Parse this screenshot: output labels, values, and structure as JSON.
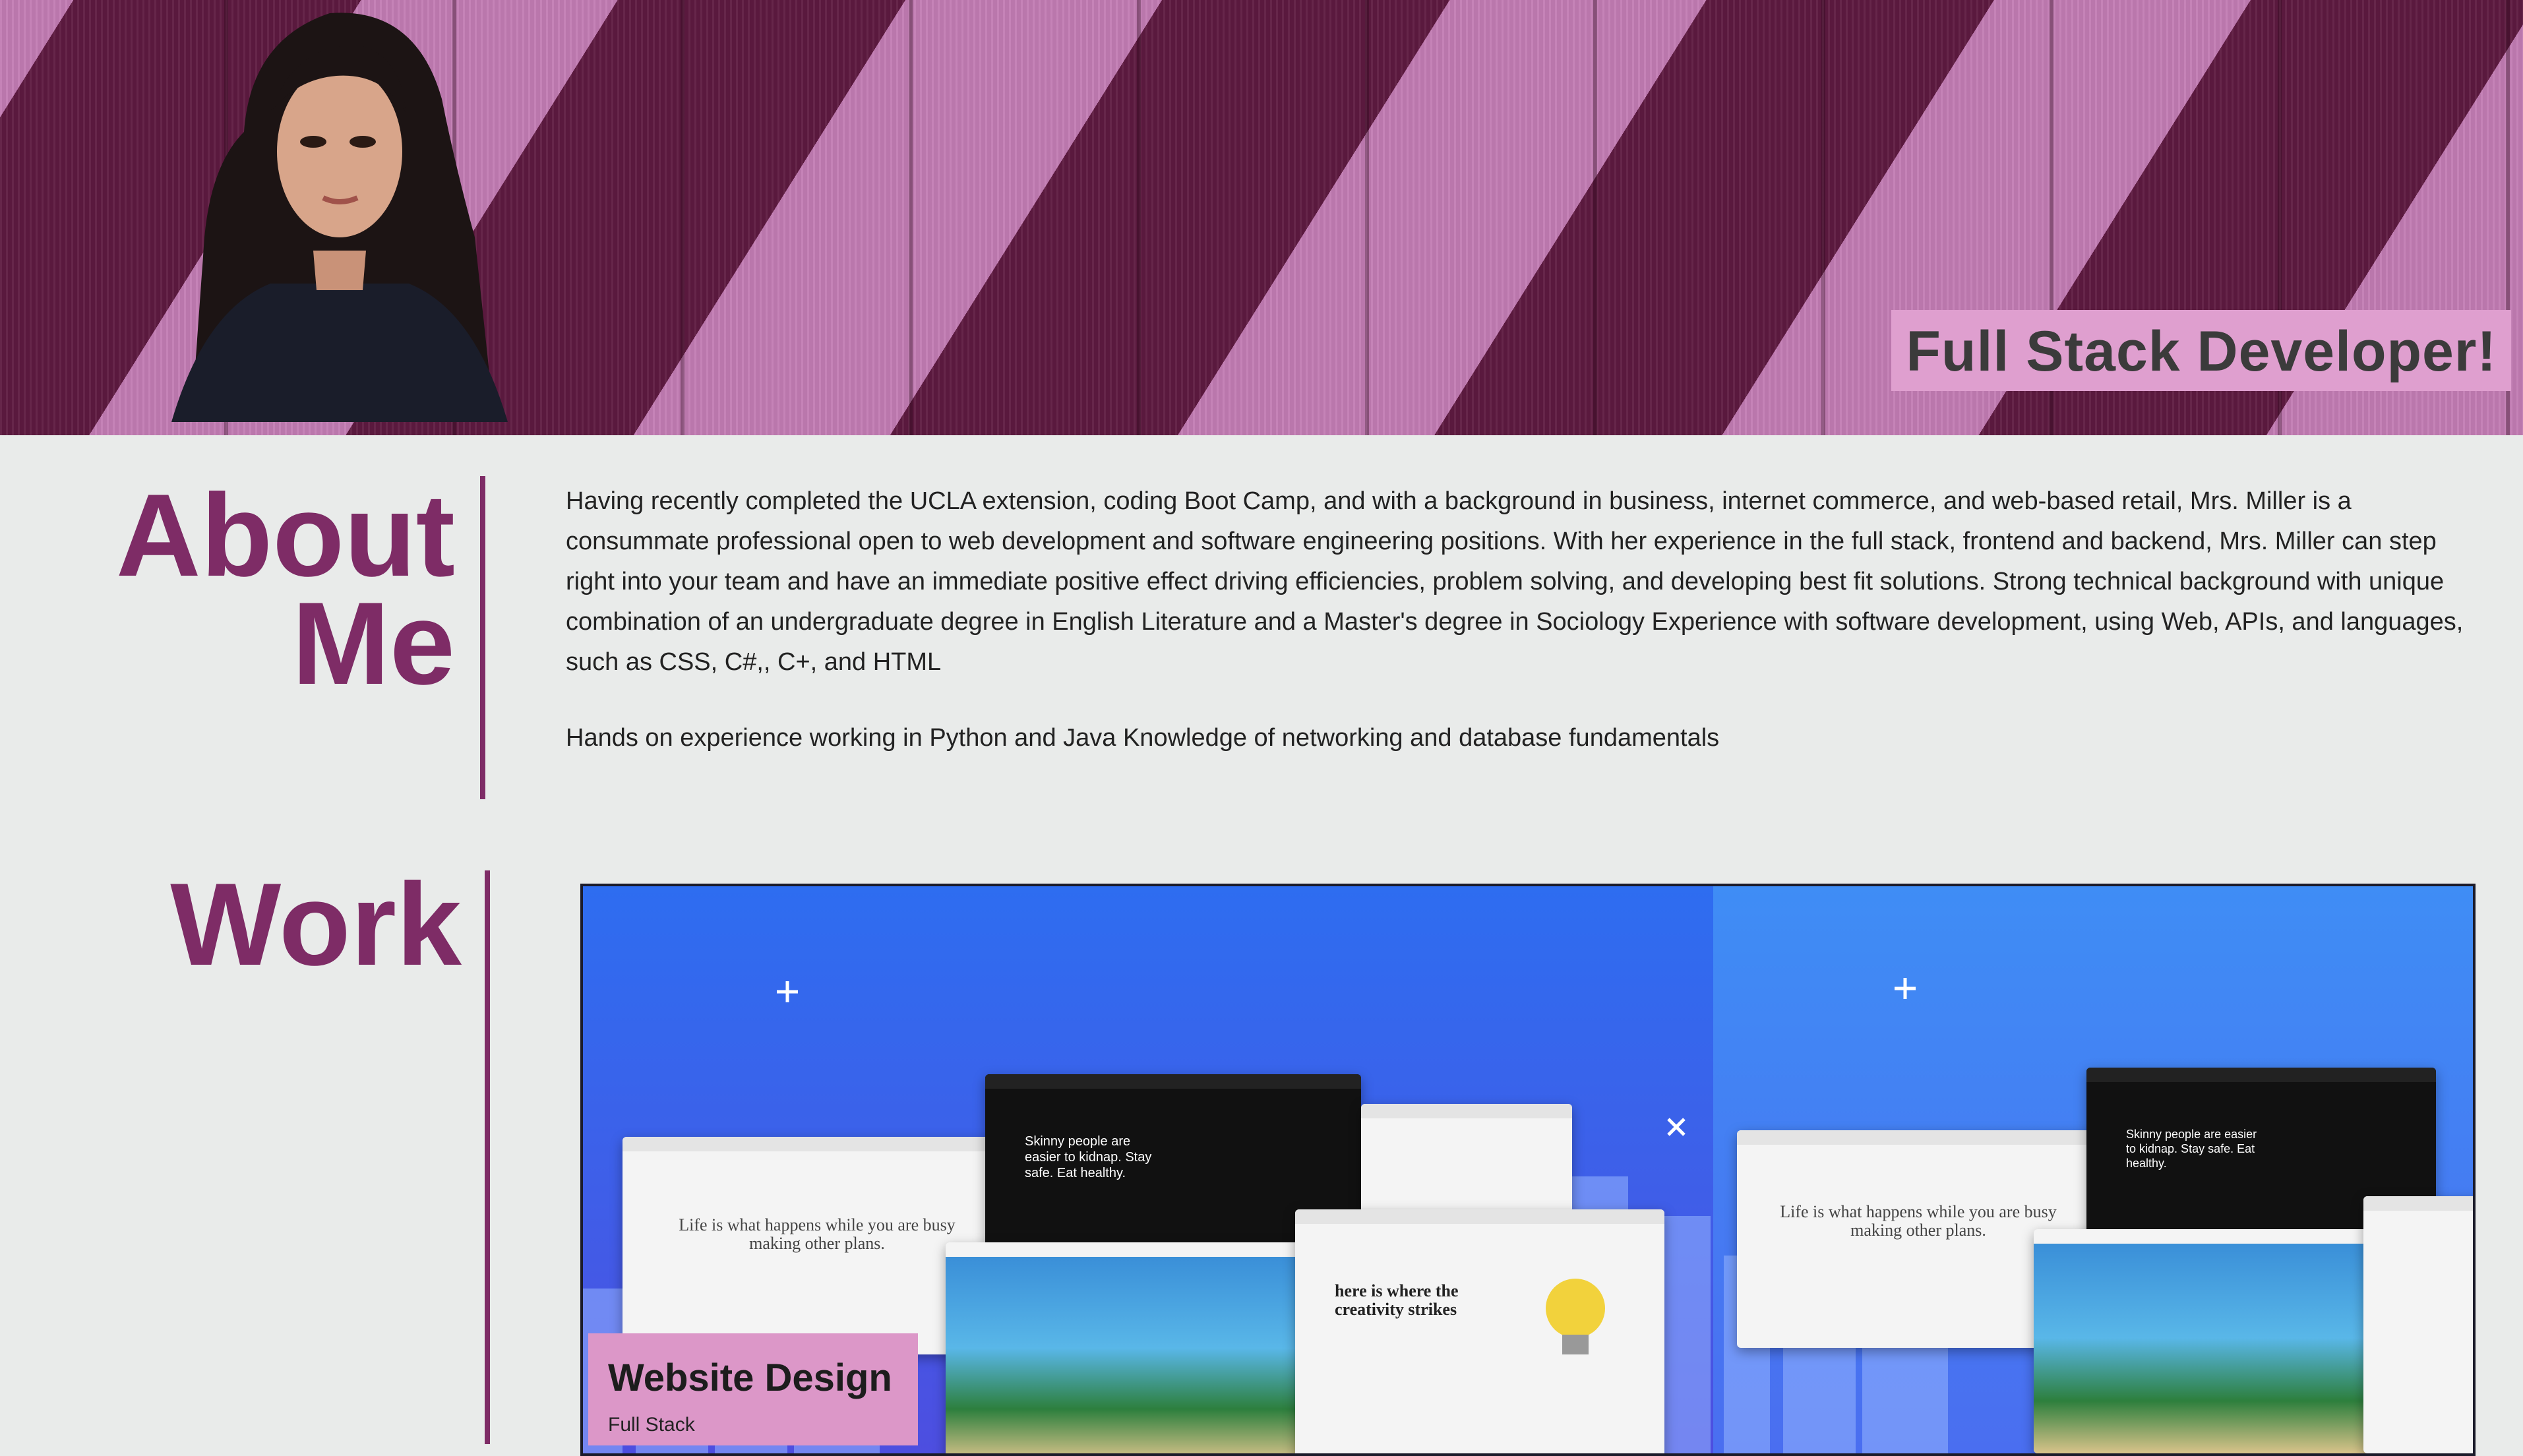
{
  "hero": {
    "title": "Full Stack Developer!"
  },
  "about": {
    "heading_line1": "About",
    "heading_line2": "Me",
    "paragraph1": "Having recently completed the UCLA extension, coding Boot Camp, and with a background in business, internet commerce, and web-based retail, Mrs. Miller is a consummate professional open to web development and software engineering positions. With her experience in the full stack, frontend and backend, Mrs. Miller can step right into your team and have an immediate positive effect driving efficiencies, problem solving, and developing best fit solutions. Strong technical background with unique combination of an undergraduate degree in English Literature and a Master's degree in Sociology Experience with software development, using Web, APIs, and languages, such as CSS, C#,, C+, and HTML",
    "paragraph2": "Hands on experience working in Python and Java Knowledge of networking and database fundamentals"
  },
  "work": {
    "heading": "Work",
    "card": {
      "title": "Website Design",
      "subtitle": "Full Stack"
    },
    "mockup_texts": {
      "tagline": "Life is what happens while you are busy making other plans.",
      "dark": "Skinny people are easier to kidnap. Stay safe. Eat healthy.",
      "creativity": "here is where the creativity strikes"
    }
  },
  "colors": {
    "accent": "#7e2c66",
    "label_bg": "#df9fcf"
  }
}
